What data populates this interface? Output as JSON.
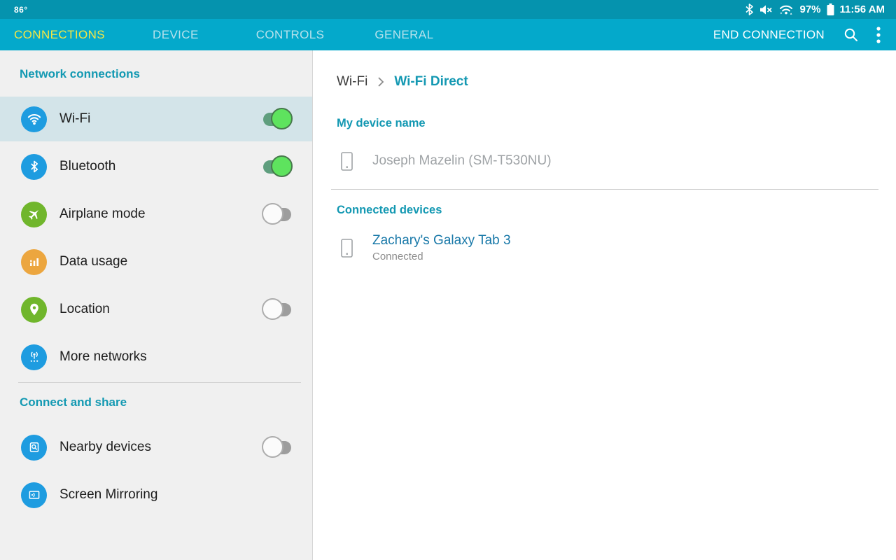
{
  "status_bar": {
    "temperature": "86°",
    "battery_percent": "97%",
    "time": "11:56 AM",
    "icons": [
      "bluetooth-icon",
      "volume-mute-icon",
      "wifi-signal-icon",
      "battery-icon"
    ]
  },
  "action_bar": {
    "tabs": [
      {
        "label": "CONNECTIONS",
        "state": "active"
      },
      {
        "label": "DEVICE"
      },
      {
        "label": "CONTROLS"
      },
      {
        "label": "GENERAL"
      }
    ],
    "end_connection_label": "END CONNECTION",
    "icons": [
      "search-icon",
      "overflow-menu-icon"
    ]
  },
  "sidebar": {
    "section1_header": "Network connections",
    "items": [
      {
        "label": "Wi-Fi",
        "icon": "wifi-icon",
        "icon_color": "#1e9ce0",
        "toggle": "on",
        "state": "selected"
      },
      {
        "label": "Bluetooth",
        "icon": "bluetooth-icon",
        "icon_color": "#1e9ce0",
        "toggle": "on"
      },
      {
        "label": "Airplane mode",
        "icon": "airplane-icon",
        "icon_color": "#70b62c",
        "toggle": "off"
      },
      {
        "label": "Data usage",
        "icon": "data-usage-icon",
        "icon_color": "#eca63f"
      },
      {
        "label": "Location",
        "icon": "location-icon",
        "icon_color": "#70b62c",
        "toggle": "off"
      },
      {
        "label": "More networks",
        "icon": "more-networks-icon",
        "icon_color": "#1e9ce0"
      }
    ],
    "section2_header": "Connect and share",
    "items2": [
      {
        "label": "Nearby devices",
        "icon": "nearby-devices-icon",
        "icon_color": "#1e9ce0",
        "toggle": "off"
      },
      {
        "label": "Screen Mirroring",
        "icon": "screen-mirroring-icon",
        "icon_color": "#1e9ce0"
      }
    ]
  },
  "content": {
    "breadcrumb": {
      "parent": "Wi-Fi",
      "current": "Wi-Fi Direct"
    },
    "my_device_header": "My device name",
    "my_device_name": "Joseph Mazelin (SM-T530NU)",
    "connected_header": "Connected devices",
    "connected_device": {
      "name": "Zachary's Galaxy Tab 3",
      "status": "Connected"
    }
  },
  "colors": {
    "status_bar_bg": "#0593ae",
    "action_bar_bg": "#04a9cb",
    "active_tab": "#f3e645",
    "inactive_tab": "#b7e2ec",
    "teal_header": "#1399b2",
    "sidebar_bg": "#f0f0f0",
    "selected_row_bg": "#d3e4e9",
    "toggle_on_knob": "#5ee35e",
    "toggle_on_track": "#5f9e7e",
    "device_link_blue": "#1878a8"
  }
}
